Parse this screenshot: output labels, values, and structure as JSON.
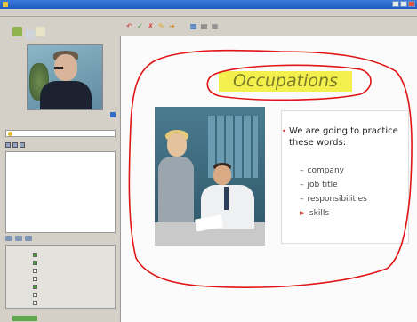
{
  "toolbar_icons": [
    "undo-icon",
    "check-icon",
    "delete-icon",
    "pen-icon",
    "arrow-icon",
    "save-icon",
    "print-icon",
    "grid-icon"
  ],
  "slide": {
    "title": "Occupations",
    "bullet_intro": "We are going to practice these words:",
    "items": [
      "company",
      "job title",
      "responsibilities",
      "skills"
    ]
  },
  "colors": {
    "title_highlight": "#f3f04d",
    "annotation": "#e01515",
    "bullet": "#cc3333",
    "titlebar": "#2f6cc6"
  }
}
